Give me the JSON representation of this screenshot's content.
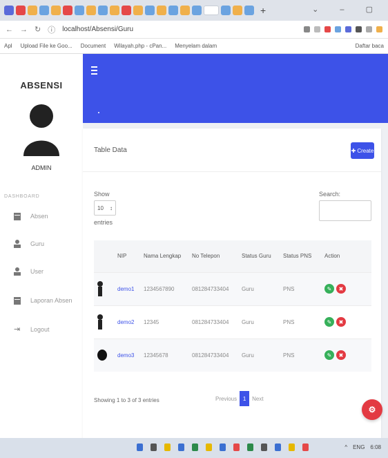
{
  "browser": {
    "url": "localhost/Absensi/Guru",
    "bookmarks": [
      "Apl",
      "Upload File ke Goo...",
      "Document",
      "Wilayah.php - cPan...",
      "Menyelam dalam"
    ],
    "reading_list": "Daftar baca"
  },
  "sidebar": {
    "brand": "ABSENSI",
    "role": "ADMIN",
    "section_label": "DASHBOARD",
    "items": [
      {
        "label": "Absen",
        "icon": "calendar-icon"
      },
      {
        "label": "Guru",
        "icon": "user-icon"
      },
      {
        "label": "User",
        "icon": "user-icon"
      },
      {
        "label": "Laporan Absen",
        "icon": "calendar-icon"
      },
      {
        "label": "Logout",
        "icon": "logout-icon"
      }
    ]
  },
  "card": {
    "title": "Table Data",
    "create_label": "Create",
    "show_label": "Show",
    "entries_value": "10",
    "entries_label": "entries",
    "search_label": "Search:",
    "columns": [
      "",
      "NIP",
      "Nama Lengkap",
      "No Telepon",
      "Status Guru",
      "Status PNS",
      "Action"
    ],
    "rows": [
      {
        "nip": "demo1",
        "nama": "1234567890",
        "telepon": "081284733404",
        "status_guru": "Guru",
        "status_pns": "PNS"
      },
      {
        "nip": "demo2",
        "nama": "12345",
        "telepon": "081284733404",
        "status_guru": "Guru",
        "status_pns": "PNS"
      },
      {
        "nip": "demo3",
        "nama": "12345678",
        "telepon": "081284733404",
        "status_guru": "Guru",
        "status_pns": "PNS"
      }
    ],
    "info": "Showing 1 to 3 of 3 entries",
    "pager": {
      "previous": "Previous",
      "current": "1",
      "next": "Next"
    }
  },
  "taskbar": {
    "lang": "ENG",
    "time": "6:08"
  },
  "colors": {
    "primary": "#3d52e8",
    "success": "#36b05a",
    "danger": "#e33a42"
  }
}
